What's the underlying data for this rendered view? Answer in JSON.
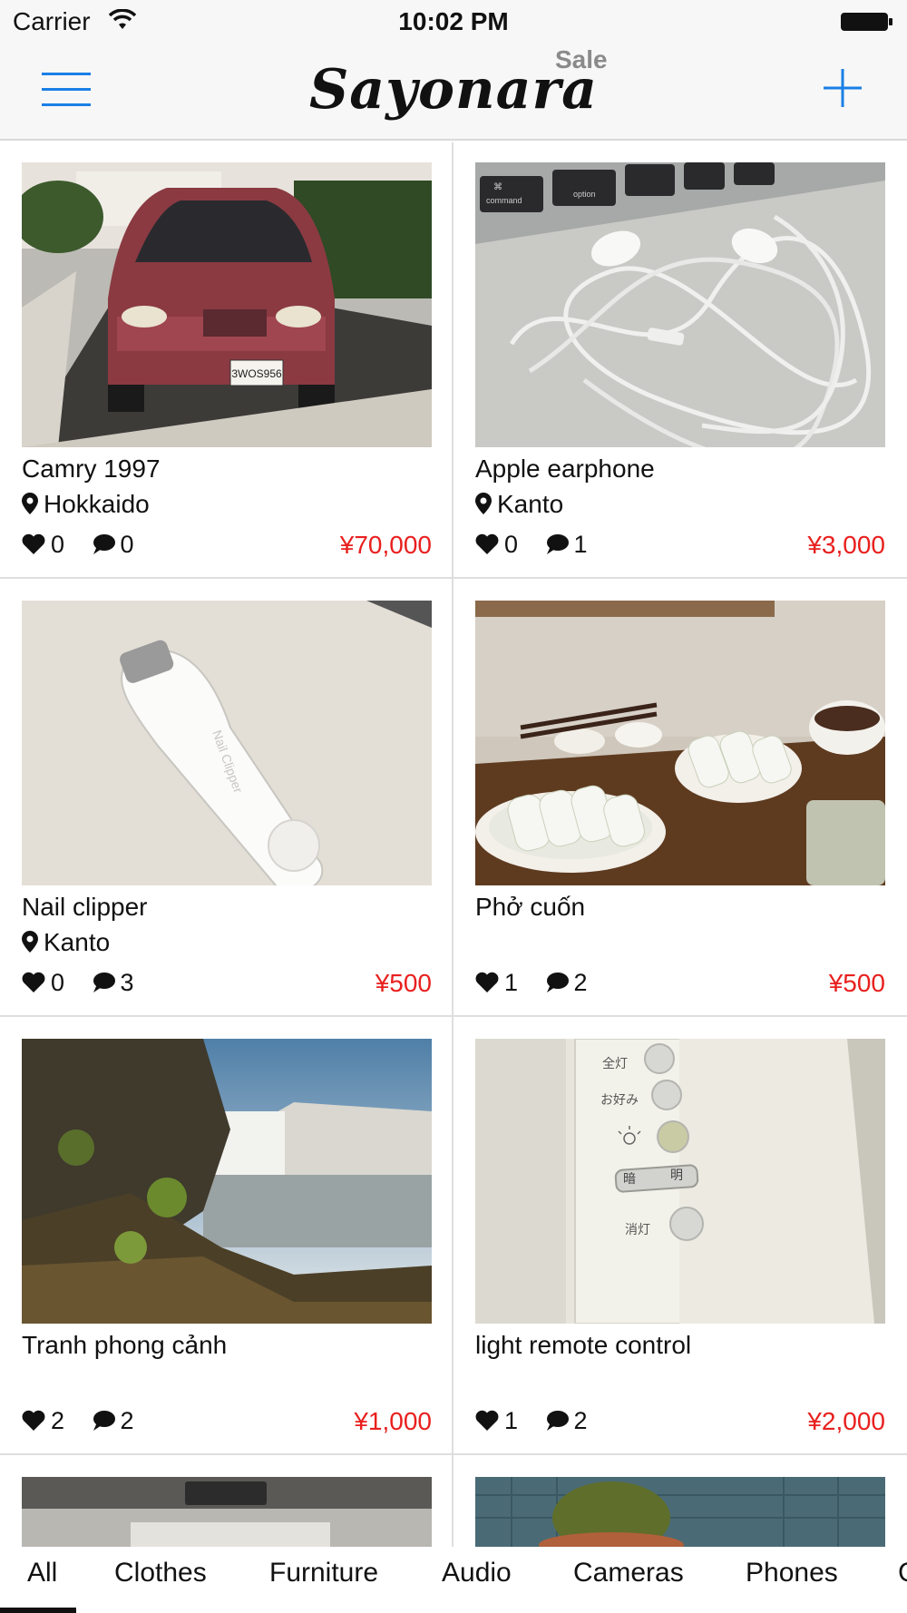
{
  "status_bar": {
    "carrier": "Carrier",
    "time": "10:02 PM"
  },
  "nav": {
    "logo": "Sayonara",
    "logo_suffix": "Sale",
    "menu_icon": "menu-icon",
    "add_icon": "plus-icon",
    "accent_color": "#1a7fe6"
  },
  "price_color": "#e8201e",
  "listings": [
    {
      "title": "Camry 1997",
      "location": "Hokkaido",
      "likes": "0",
      "comments": "0",
      "price": "¥70,000"
    },
    {
      "title": "Apple earphone",
      "location": "Kanto",
      "likes": "0",
      "comments": "1",
      "price": "¥3,000"
    },
    {
      "title": "Nail clipper",
      "location": "Kanto",
      "likes": "0",
      "comments": "3",
      "price": "¥500"
    },
    {
      "title": "Phở cuốn",
      "location": "",
      "likes": "1",
      "comments": "2",
      "price": "¥500"
    },
    {
      "title": "Tranh phong cảnh",
      "location": "",
      "likes": "2",
      "comments": "2",
      "price": "¥1,000"
    },
    {
      "title": "light remote control",
      "location": "",
      "likes": "1",
      "comments": "2",
      "price": "¥2,000"
    }
  ],
  "photo_text": {
    "license_plate": "3WOS956",
    "key_command": "command",
    "key_option": "option",
    "key_symbol": "⌘",
    "clipper_brand": "Nail Clipper",
    "remote_all": "全灯",
    "remote_fav": "お好み",
    "remote_dim": "暗",
    "remote_bright": "明",
    "remote_off": "消灯"
  },
  "tabs": [
    "All",
    "Clothes",
    "Furniture",
    "Audio",
    "Cameras",
    "Phones",
    "C"
  ],
  "active_tab": "All"
}
